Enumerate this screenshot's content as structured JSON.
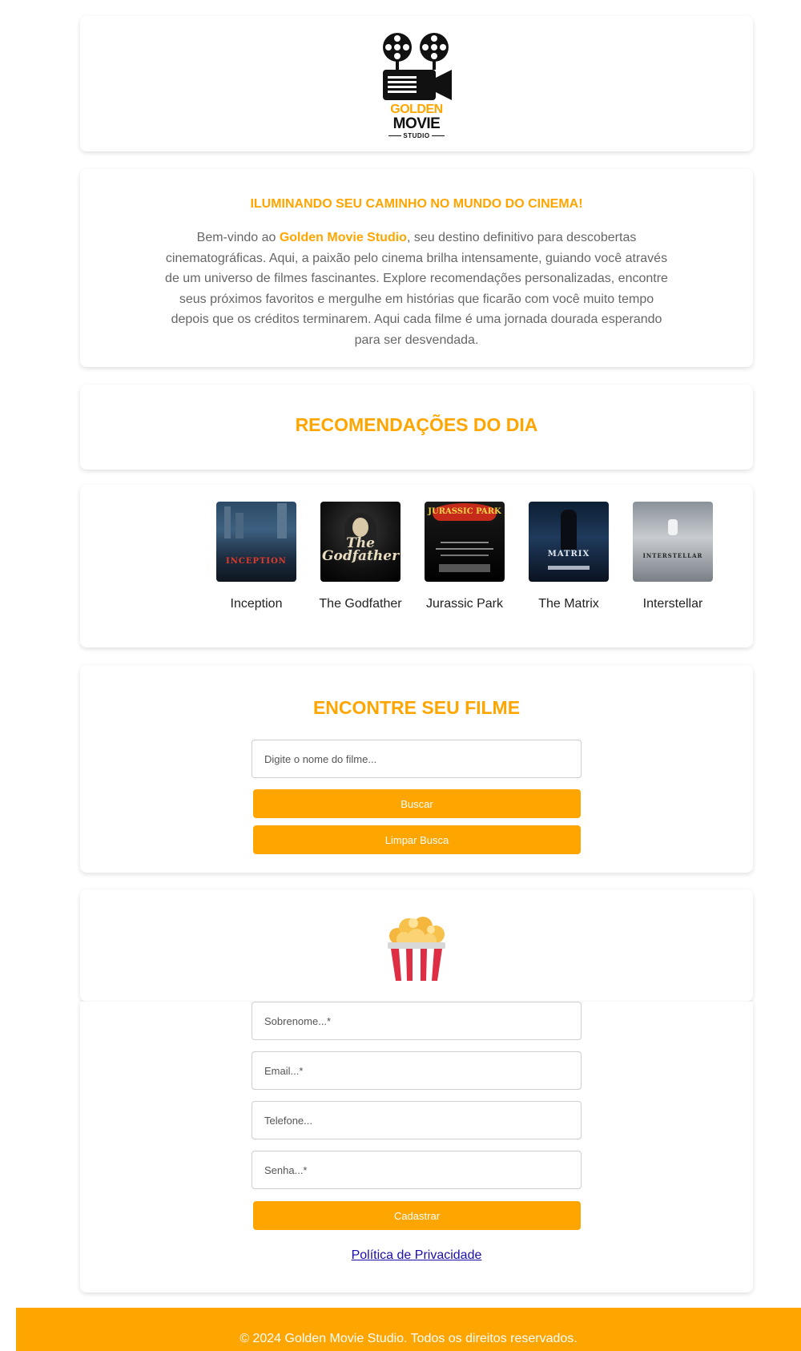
{
  "header": {
    "logo": {
      "line1": "GOLDEN",
      "line2": "MOVIE",
      "line3": "STUDIO"
    }
  },
  "intro": {
    "heading": "ILUMINANDO SEU CAMINHO NO MUNDO DO CINEMA!",
    "text_before": "Bem-vindo ao ",
    "brand": "Golden Movie Studio",
    "text_after": ", seu destino definitivo para descobertas cinematográficas. Aqui, a paixão pelo cinema brilha intensamente, guiando você através de um universo de filmes fascinantes. Explore recomendações personalizadas, encontre seus próximos favoritos e mergulhe em histórias que ficarão com você muito tempo depois que os créditos terminarem. Aqui cada filme é uma jornada dourada esperando para ser desvendada."
  },
  "recommendations": {
    "title": "RECOMENDAÇÕES DO DIA",
    "movies": [
      {
        "title": "Inception",
        "poster_text": "INCEPTION"
      },
      {
        "title": "The Godfather",
        "poster_text": "The Godfather"
      },
      {
        "title": "Jurassic Park",
        "poster_text": "JURASSIC PARK"
      },
      {
        "title": "The Matrix",
        "poster_text": "MATRIX"
      },
      {
        "title": "Interstellar",
        "poster_text": "INTERSTELLAR"
      }
    ]
  },
  "search": {
    "title": "ENCONTRE SEU FILME",
    "placeholder": "Digite o nome do filme...",
    "search_button": "Buscar",
    "clear_button": "Limpar Busca"
  },
  "register": {
    "icon": "popcorn-icon",
    "surname_placeholder": "Sobrenome...*",
    "email_placeholder": "Email...*",
    "phone_placeholder": "Telefone...",
    "password_placeholder": "Senha...*",
    "submit_button": "Cadastrar",
    "privacy_link": "Política de Privacidade"
  },
  "footer": {
    "text": "© 2024 Golden Movie Studio. Todos os direitos reservados."
  },
  "colors": {
    "accent": "#ffa500",
    "body_text": "#666666",
    "link": "#1a0dab"
  }
}
